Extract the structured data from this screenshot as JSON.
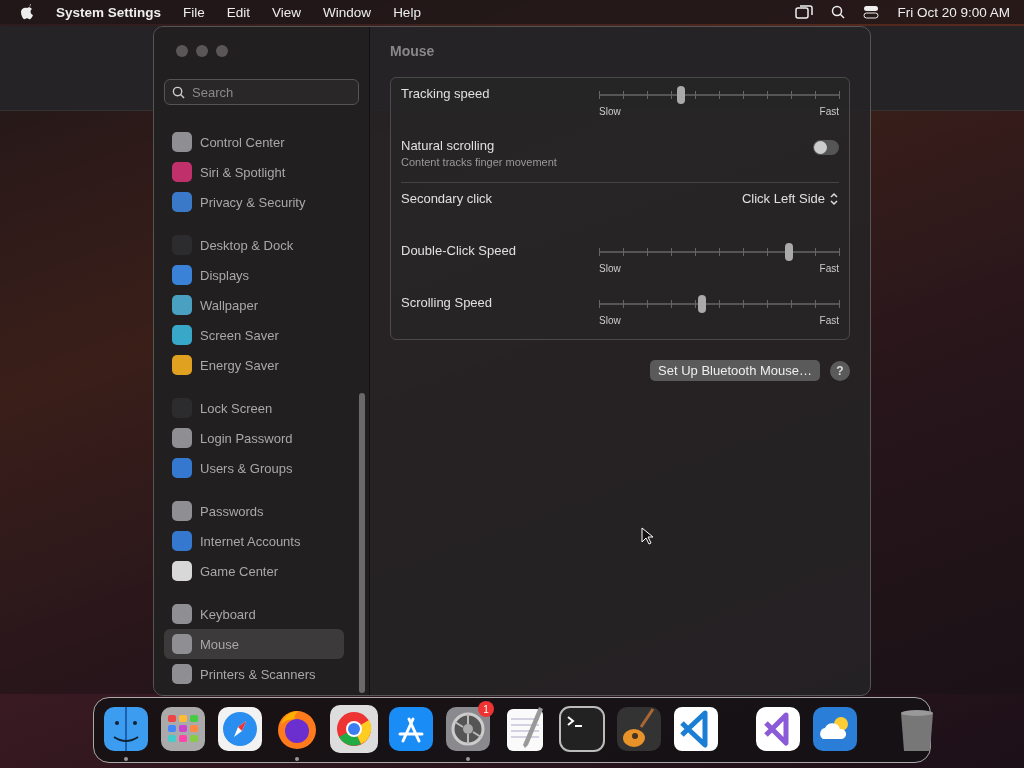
{
  "menu_bar": {
    "app_name": "System Settings",
    "menus": [
      "File",
      "Edit",
      "View",
      "Window",
      "Help"
    ],
    "clock": "Fri Oct 20  9:00 AM"
  },
  "sidebar": {
    "search": {
      "placeholder": "Search"
    },
    "groups": [
      [
        {
          "label": "Control Center",
          "selected": false,
          "color": "#8e8e93"
        },
        {
          "label": "Siri & Spotlight",
          "selected": false,
          "color": "#c0306a"
        },
        {
          "label": "Privacy & Security",
          "selected": false,
          "color": "#3a78c8"
        }
      ],
      [
        {
          "label": "Desktop & Dock",
          "selected": false,
          "color": "#2c2c2e"
        },
        {
          "label": "Displays",
          "selected": false,
          "color": "#3a82d8"
        },
        {
          "label": "Wallpaper",
          "selected": false,
          "color": "#4aa0c0"
        },
        {
          "label": "Screen Saver",
          "selected": false,
          "color": "#38a8c8"
        },
        {
          "label": "Energy Saver",
          "selected": false,
          "color": "#e0a020"
        }
      ],
      [
        {
          "label": "Lock Screen",
          "selected": false,
          "color": "#2c2c2e"
        },
        {
          "label": "Login Password",
          "selected": false,
          "color": "#8e8e93"
        },
        {
          "label": "Users & Groups",
          "selected": false,
          "color": "#3478d0"
        }
      ],
      [
        {
          "label": "Passwords",
          "selected": false,
          "color": "#8e8e93"
        },
        {
          "label": "Internet Accounts",
          "selected": false,
          "color": "#3478d0"
        },
        {
          "label": "Game Center",
          "selected": false,
          "color": "#d8d8d8"
        }
      ],
      [
        {
          "label": "Keyboard",
          "selected": false,
          "color": "#8e8e93"
        },
        {
          "label": "Mouse",
          "selected": true,
          "color": "#8e8e93"
        },
        {
          "label": "Printers & Scanners",
          "selected": false,
          "color": "#8e8e93"
        }
      ]
    ]
  },
  "content": {
    "title": "Mouse",
    "settings": [
      {
        "kind": "slider",
        "label": "Tracking speed",
        "level": 0.34,
        "min_label": "Slow",
        "max_label": "Fast"
      },
      {
        "kind": "toggle",
        "label": "Natural scrolling",
        "description": "Content tracks finger movement",
        "on": false
      },
      {
        "kind": "popup",
        "label": "Secondary click",
        "value": "Click Left Side"
      },
      {
        "kind": "slider",
        "label": "Double-Click Speed",
        "level": 0.79,
        "min_label": "Slow",
        "max_label": "Fast"
      },
      {
        "kind": "slider",
        "label": "Scrolling Speed",
        "level": 0.43,
        "min_label": "Slow",
        "max_label": "Fast"
      }
    ],
    "setup_button": "Set Up Bluetooth Mouse…",
    "help_button": "?"
  },
  "dock": {
    "apps": [
      {
        "kind": "finder",
        "running": true
      },
      {
        "kind": "launchpad",
        "running": false
      },
      {
        "kind": "safari",
        "running": false
      },
      {
        "kind": "firefox",
        "running": true
      },
      {
        "kind": "chrome",
        "running": false
      },
      {
        "kind": "appstore",
        "running": false
      },
      {
        "kind": "settings",
        "running": true,
        "badge": "1"
      },
      {
        "kind": "textedit",
        "running": false
      },
      {
        "kind": "terminal",
        "running": false
      },
      {
        "kind": "garageband",
        "running": false
      },
      {
        "kind": "vscode",
        "running": false
      },
      {
        "kind": "separator"
      },
      {
        "kind": "visualstudio",
        "running": false
      },
      {
        "kind": "weather",
        "running": false
      },
      {
        "kind": "separator"
      },
      {
        "kind": "trash",
        "running": false
      }
    ]
  }
}
